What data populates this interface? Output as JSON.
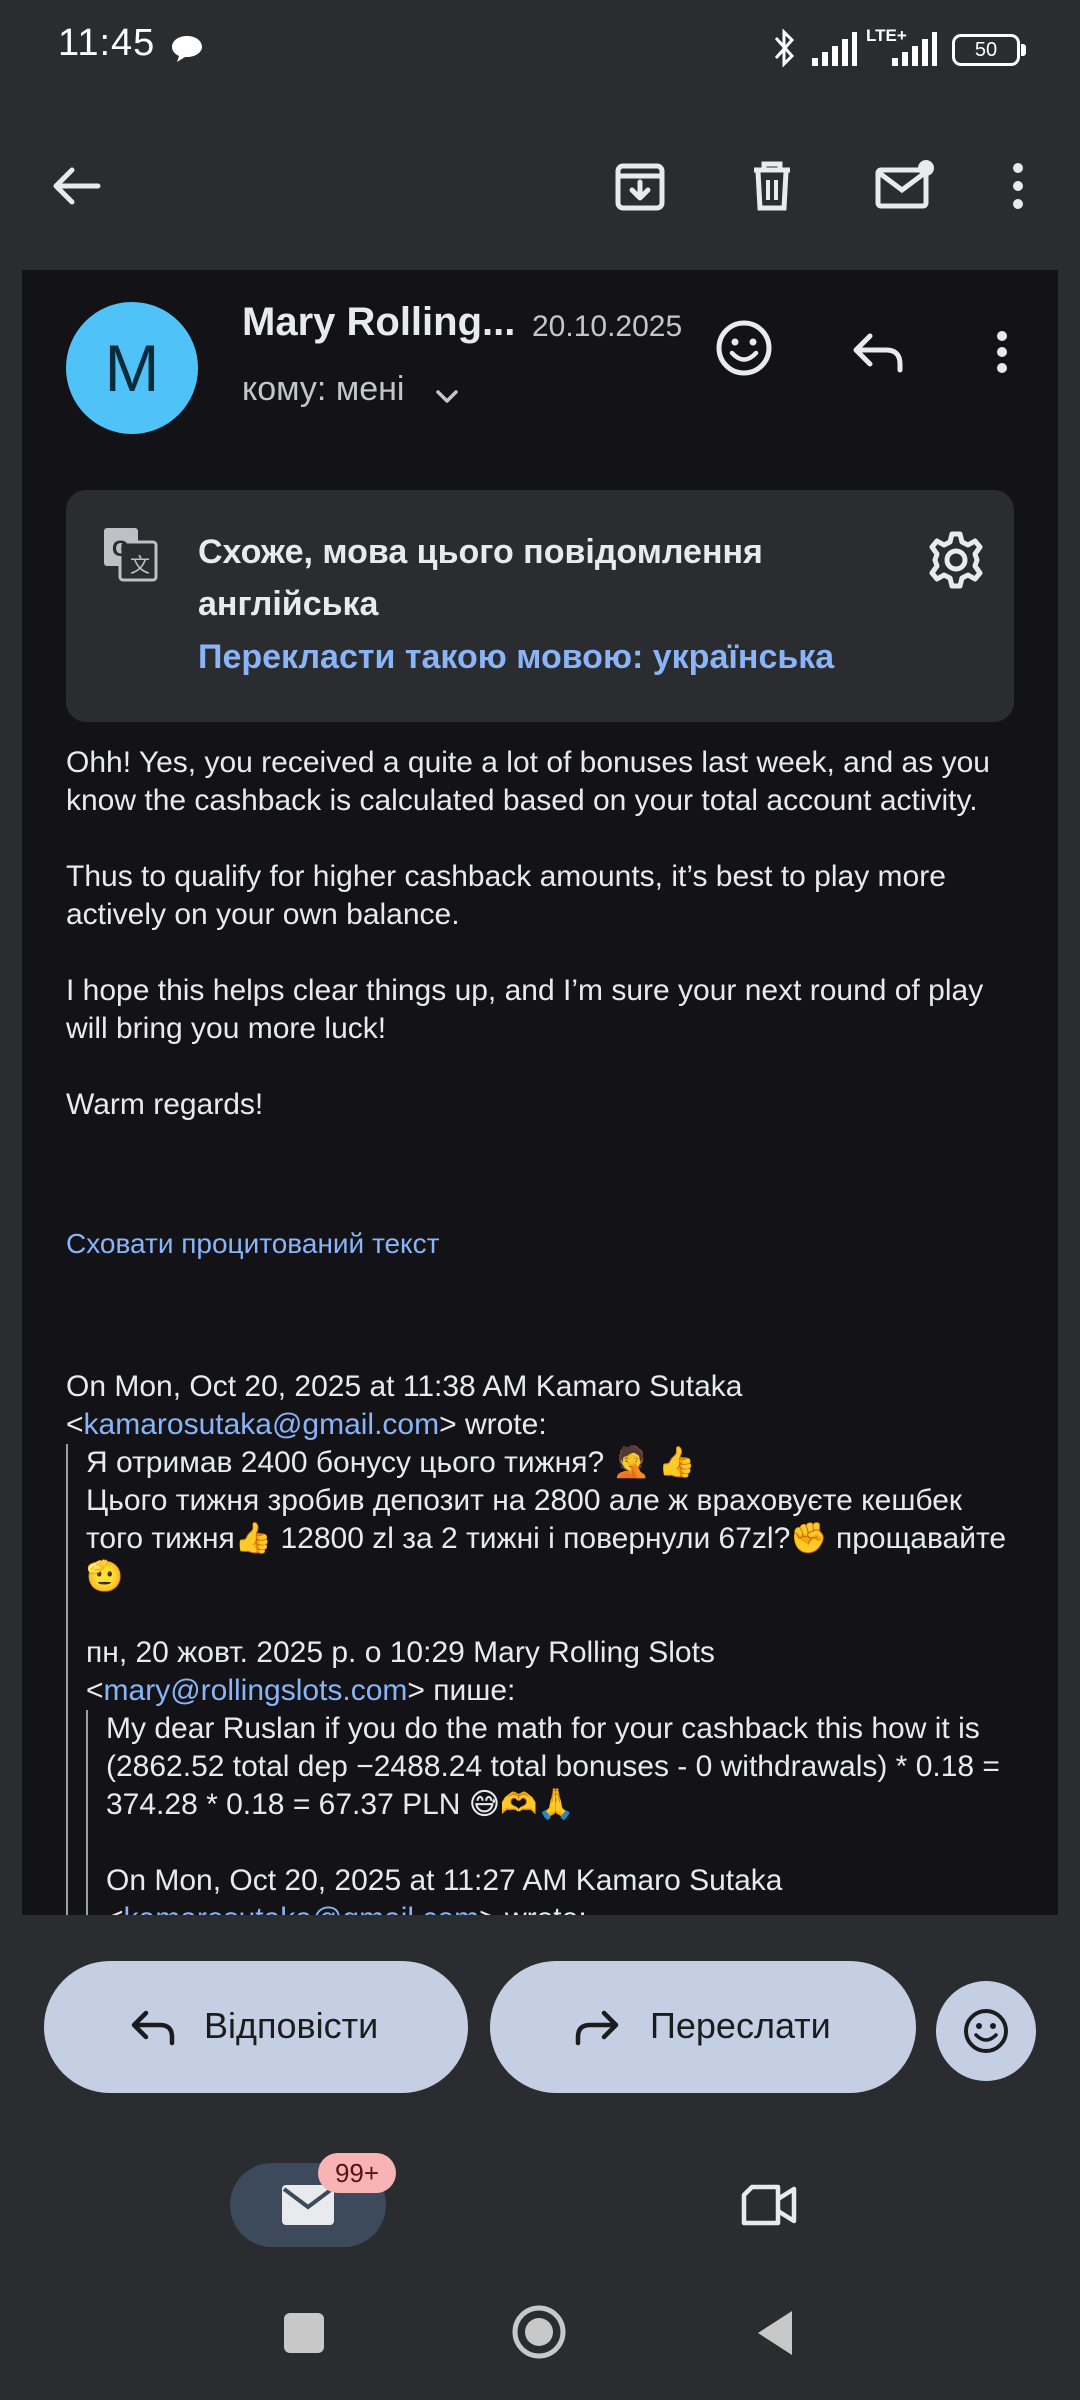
{
  "status_bar": {
    "time": "11:45",
    "network": "LTE+",
    "battery": "50"
  },
  "toolbar": {
    "back": "back-arrow-icon",
    "archive": "archive-icon",
    "delete": "trash-icon",
    "unread": "mark-unread-icon",
    "more": "more-vert-icon"
  },
  "email": {
    "avatar_letter": "M",
    "sender": "Mary Rolling...",
    "date": "20.10.2025",
    "recipient": "кому: мені"
  },
  "translate": {
    "title": "Схоже, мова цього повідомлення англійська",
    "action": "Перекласти такою мовою: українська"
  },
  "body": {
    "paragraphs": [
      "Ohh! Yes, you received a quite a lot of bonuses last week, and as you know the cashback is calculated based on your total account activity.",
      "Thus to qualify for higher cashback amounts, it’s best to play more actively on your own balance.",
      "I hope this helps clear things up, and I’m sure your next round of play will bring you more luck!",
      "Warm regards!"
    ],
    "hide_quoted": "Сховати процитований текст"
  },
  "quote": {
    "header1_pre": "On Mon, Oct 20, 2025 at 11:38 AM Kamaro Sutaka",
    "header1_lt": "<",
    "header1_email": "kamarosutaka@gmail.com",
    "header1_post": "> wrote:",
    "lines1": [
      "Я отримав 2400 бонусу цього тижня? 🤦 👍",
      "Цього тижня зробив депозит на 2800 але ж враховуєте кешбек того тижня👍 12800 zl за 2 тижні і повернули 67zl?✊ прощавайте🫡"
    ],
    "header2_pre": "пн, 20 жовт. 2025 р. о 10:29 Mary Rolling Slots",
    "header2_lt": "<",
    "header2_email": "mary@rollingslots.com",
    "header2_post": "> пише:",
    "lines2": "My dear Ruslan if you do the math for your cashback this how it is (2862.52 total dep −2488.24 total bonuses - 0 withdrawals) * 0.18 = 374.28 * 0.18 = 67.37 PLN 😅🫶🙏",
    "header3_pre": "On Mon, Oct 20, 2025 at 11:27 AM Kamaro Sutaka",
    "header3_lt": "<",
    "header3_email": "kamarosutaka@gmail.com",
    "header3_post": "> wrote:"
  },
  "actions": {
    "reply": "Відповісти",
    "forward": "Переслати"
  },
  "nav": {
    "mail_badge": "99+"
  },
  "colors": {
    "accent": "#8ab4f8",
    "avatar": "#4fc3f7",
    "pill": "#c5cfe3"
  }
}
